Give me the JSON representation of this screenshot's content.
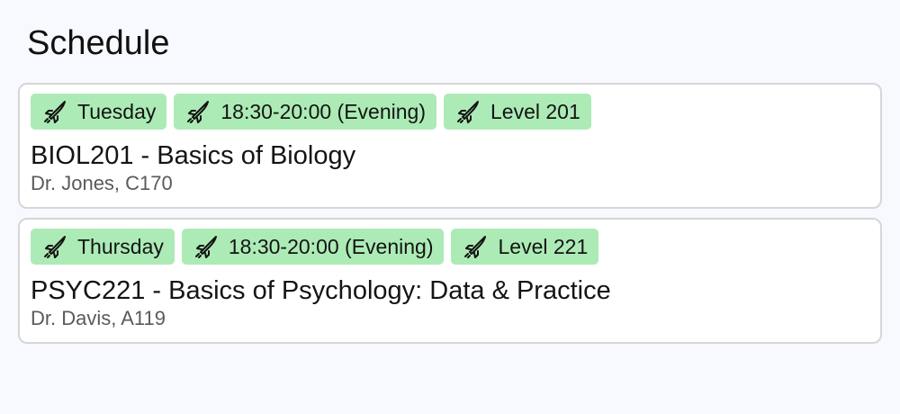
{
  "page": {
    "title": "Schedule"
  },
  "courses": [
    {
      "tags": [
        {
          "icon": "rocket-icon",
          "label": "Tuesday"
        },
        {
          "icon": "rocket-icon",
          "label": "18:30-20:00 (Evening)"
        },
        {
          "icon": "rocket-icon",
          "label": "Level 201"
        }
      ],
      "title": "BIOL201 - Basics of Biology",
      "meta": "Dr. Jones, C170"
    },
    {
      "tags": [
        {
          "icon": "rocket-icon",
          "label": "Thursday"
        },
        {
          "icon": "rocket-icon",
          "label": "18:30-20:00 (Evening)"
        },
        {
          "icon": "rocket-icon",
          "label": "Level 221"
        }
      ],
      "title": "PSYC221 - Basics of Psychology: Data & Practice",
      "meta": "Dr. Davis, A119"
    }
  ],
  "colors": {
    "background": "#f8f9fe",
    "card_border": "#d6d6d6",
    "tag_background": "#acebb5",
    "meta_text": "#5a5a5a"
  }
}
